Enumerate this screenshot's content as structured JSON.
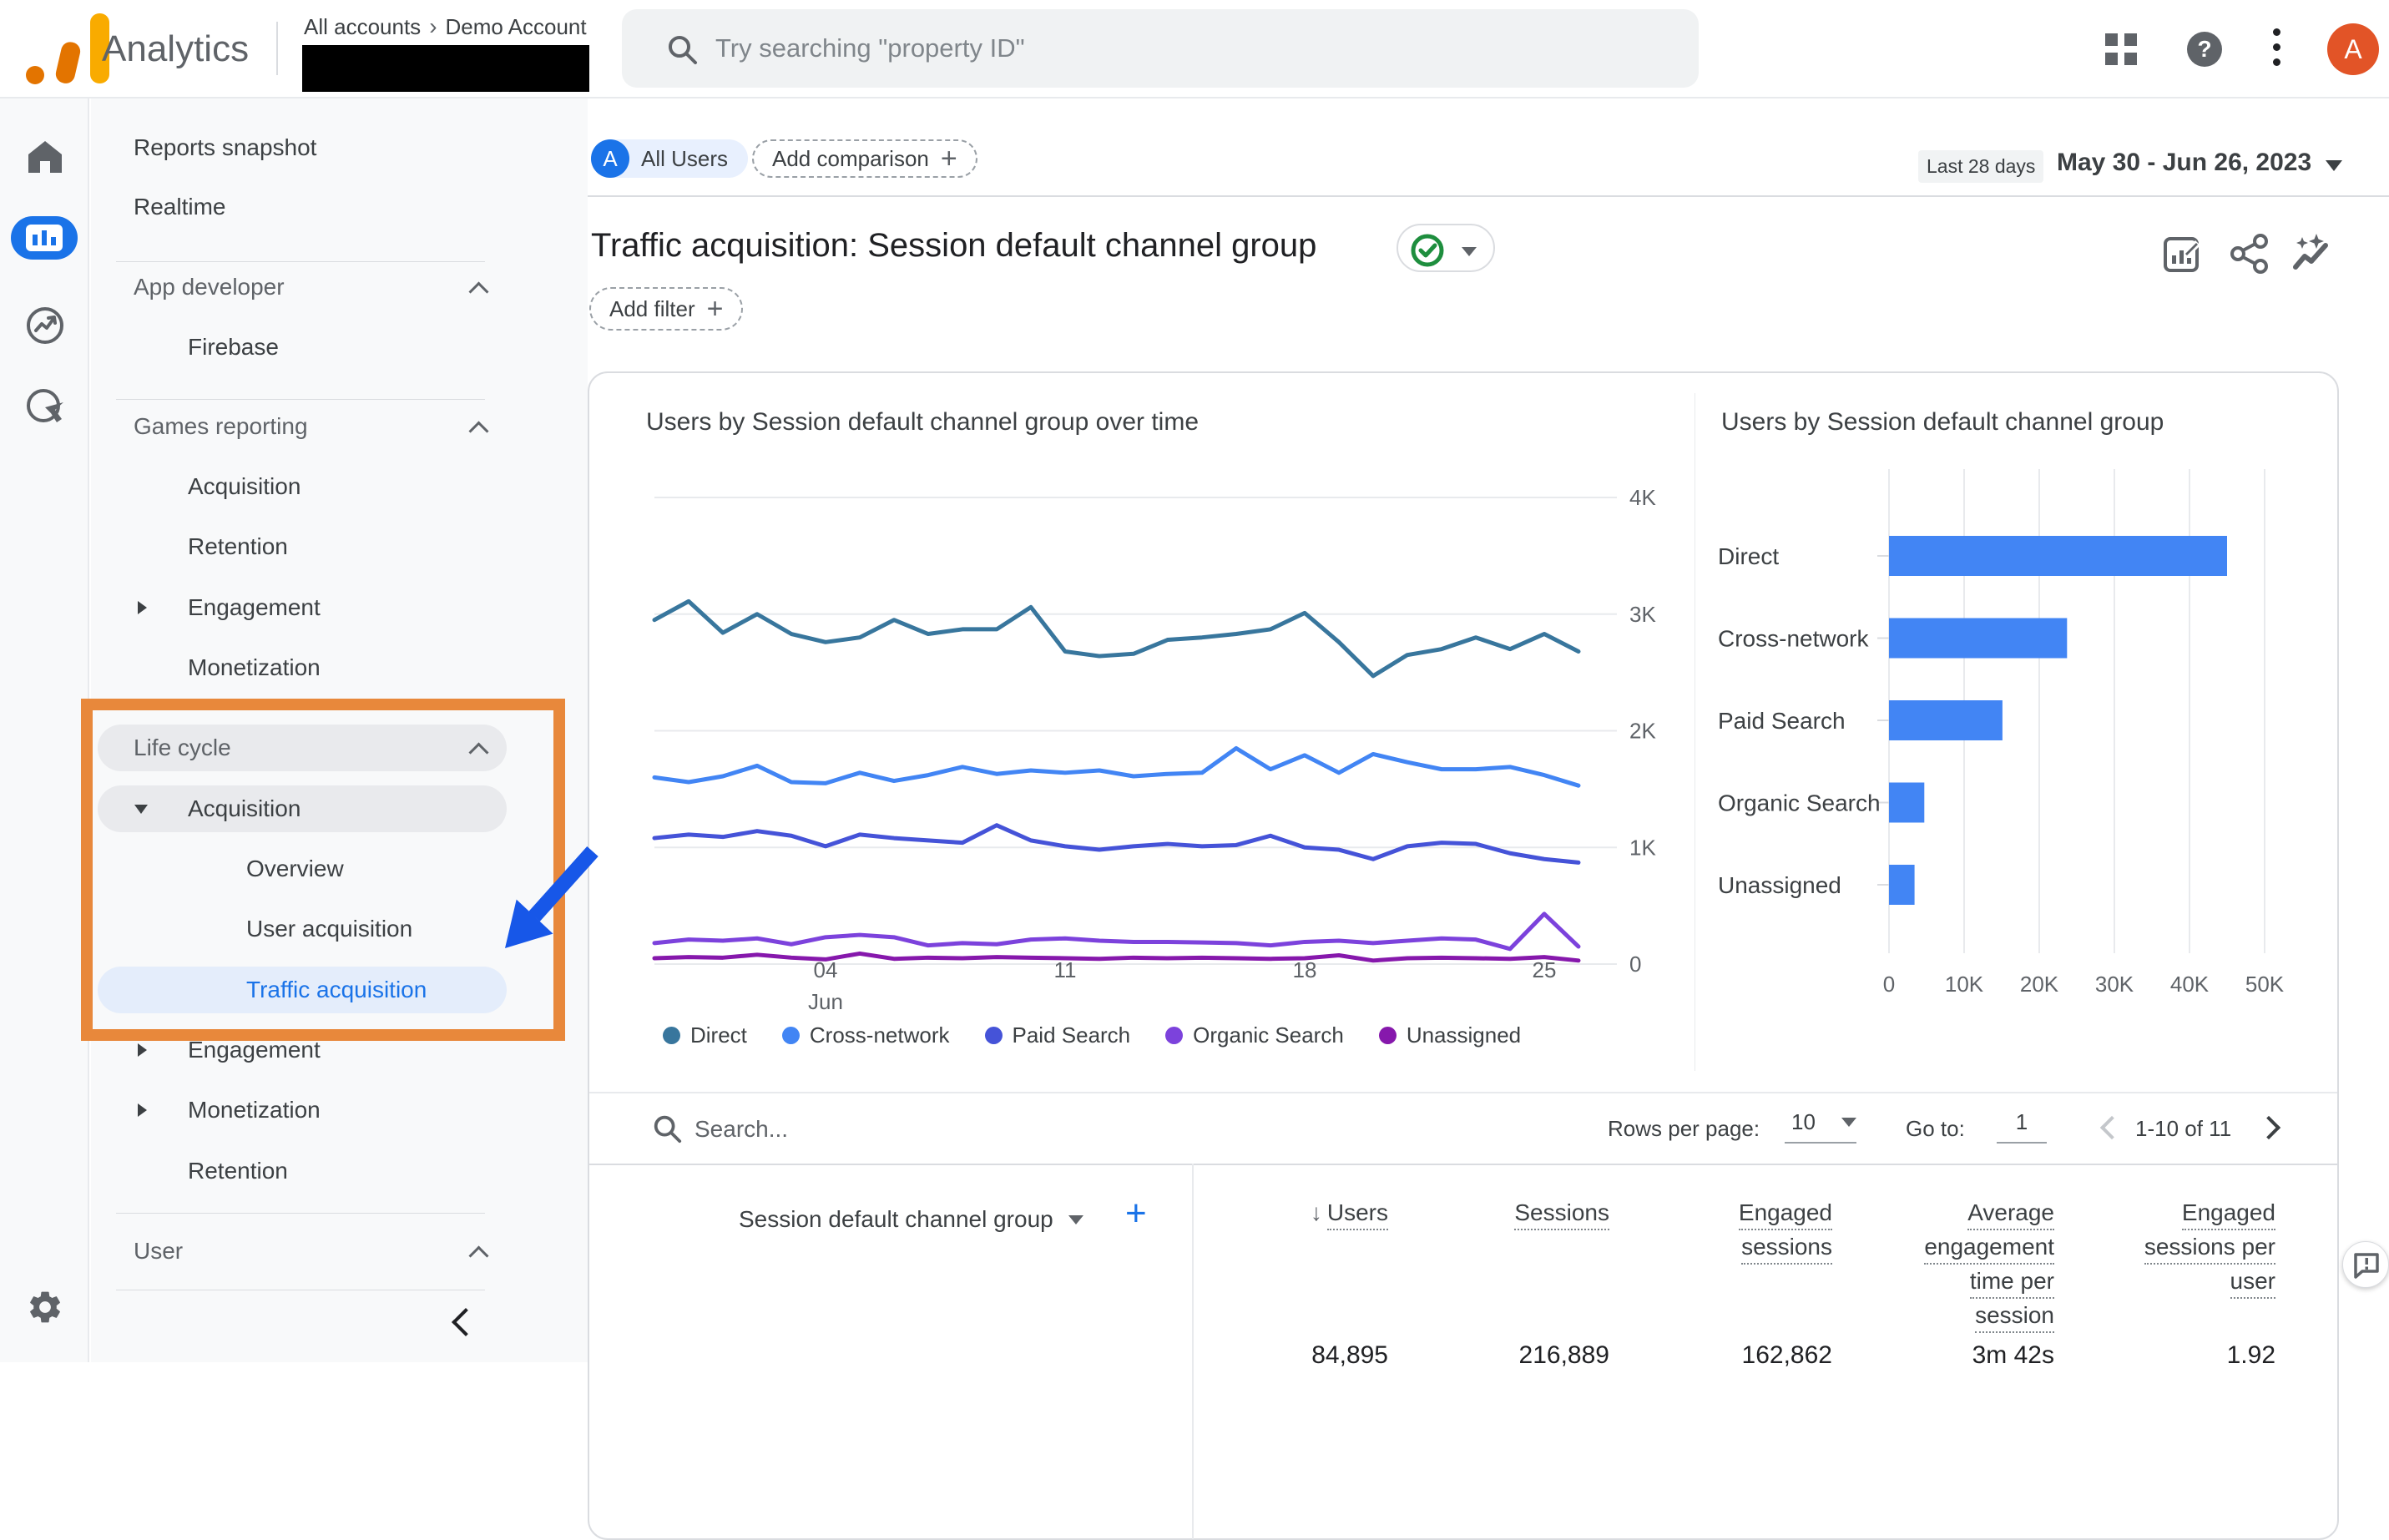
{
  "topbar": {
    "product": "Analytics",
    "breadcrumb": {
      "root": "All accounts",
      "account": "Demo Account"
    },
    "search_placeholder": "Try searching \"property ID\"",
    "avatar_letter": "A"
  },
  "rail": {
    "items": [
      "home",
      "reports",
      "explore",
      "advertising"
    ],
    "selected": "reports",
    "bottom": "settings"
  },
  "sidenav": {
    "items": [
      {
        "type": "item",
        "label": "Reports snapshot",
        "indent": 1
      },
      {
        "type": "item",
        "label": "Realtime",
        "indent": 1
      },
      {
        "type": "divider"
      },
      {
        "type": "header",
        "label": "App developer"
      },
      {
        "type": "item",
        "label": "Firebase",
        "indent": 2
      },
      {
        "type": "divider"
      },
      {
        "type": "header",
        "label": "Games reporting"
      },
      {
        "type": "item",
        "label": "Acquisition",
        "indent": 2
      },
      {
        "type": "item",
        "label": "Retention",
        "indent": 2
      },
      {
        "type": "item",
        "label": "Engagement",
        "indent": 2,
        "expand": "collapsed"
      },
      {
        "type": "item",
        "label": "Monetization",
        "indent": 2
      },
      {
        "type": "header",
        "label": "Life cycle",
        "pill": true
      },
      {
        "type": "item",
        "label": "Acquisition",
        "indent": 2,
        "expand": "expanded",
        "pill": "grey"
      },
      {
        "type": "item",
        "label": "Overview",
        "indent": 3
      },
      {
        "type": "item",
        "label": "User acquisition",
        "indent": 3
      },
      {
        "type": "item",
        "label": "Traffic acquisition",
        "indent": 3,
        "selected": true
      },
      {
        "type": "item",
        "label": "Engagement",
        "indent": 2,
        "expand": "collapsed"
      },
      {
        "type": "item",
        "label": "Monetization",
        "indent": 2,
        "expand": "collapsed"
      },
      {
        "type": "item",
        "label": "Retention",
        "indent": 2
      },
      {
        "type": "divider"
      },
      {
        "type": "header",
        "label": "User"
      },
      {
        "type": "divider"
      }
    ]
  },
  "header": {
    "all_users_chip": "All Users",
    "chip_avatar": "A",
    "add_comparison": "Add comparison",
    "date_range_label": "Last 28 days",
    "date_range": "May 30 - Jun 26, 2023",
    "title": "Traffic acquisition: Session default channel group",
    "add_filter": "Add filter"
  },
  "chart_data": [
    {
      "type": "line",
      "title": "Users by Session default channel group over time",
      "ylabel": "",
      "xlabel": "",
      "ylim": [
        0,
        4000
      ],
      "yticks": [
        "0",
        "1K",
        "2K",
        "3K",
        "4K"
      ],
      "x_ticks": [
        {
          "index": 5,
          "label": "04",
          "sublabel": "Jun"
        },
        {
          "index": 12,
          "label": "11"
        },
        {
          "index": 19,
          "label": "18"
        },
        {
          "index": 26,
          "label": "25"
        }
      ],
      "series": [
        {
          "name": "Direct",
          "color": "#38769d",
          "values": [
            2950,
            3110,
            2840,
            3000,
            2830,
            2760,
            2800,
            2950,
            2830,
            2870,
            2870,
            3060,
            2680,
            2640,
            2660,
            2780,
            2800,
            2830,
            2870,
            3010,
            2760,
            2470,
            2650,
            2700,
            2800,
            2700,
            2830,
            2680
          ]
        },
        {
          "name": "Cross-network",
          "color": "#4285f4",
          "values": [
            1600,
            1560,
            1610,
            1700,
            1560,
            1550,
            1640,
            1570,
            1620,
            1690,
            1630,
            1660,
            1640,
            1660,
            1610,
            1630,
            1640,
            1850,
            1670,
            1790,
            1640,
            1800,
            1730,
            1670,
            1670,
            1690,
            1620,
            1530
          ]
        },
        {
          "name": "Paid Search",
          "color": "#4553d8",
          "values": [
            1080,
            1110,
            1090,
            1140,
            1100,
            1010,
            1110,
            1080,
            1060,
            1040,
            1190,
            1060,
            1010,
            980,
            1010,
            1030,
            1010,
            1020,
            1100,
            1000,
            980,
            900,
            1010,
            1040,
            1030,
            950,
            900,
            870
          ]
        },
        {
          "name": "Organic Search",
          "color": "#7c42dc",
          "values": [
            180,
            210,
            200,
            220,
            170,
            230,
            250,
            230,
            160,
            180,
            170,
            210,
            220,
            200,
            190,
            190,
            185,
            180,
            160,
            190,
            200,
            180,
            200,
            220,
            210,
            130,
            430,
            150
          ]
        },
        {
          "name": "Unassigned",
          "color": "#8618ac",
          "values": [
            50,
            60,
            55,
            80,
            55,
            40,
            90,
            45,
            55,
            50,
            60,
            55,
            50,
            45,
            55,
            50,
            55,
            50,
            45,
            50,
            75,
            30,
            50,
            55,
            50,
            45,
            60,
            30
          ]
        }
      ]
    },
    {
      "type": "bar",
      "title": "Users by Session default channel group",
      "categories": [
        "Direct",
        "Cross-network",
        "Paid Search",
        "Organic Search",
        "Unassigned"
      ],
      "values": [
        45000,
        23700,
        15100,
        4700,
        3400
      ],
      "xlim": [
        0,
        50000
      ],
      "xticks": [
        "0",
        "10K",
        "20K",
        "30K",
        "40K",
        "50K"
      ],
      "bar_color": "#4285f4"
    }
  ],
  "table": {
    "search_placeholder": "Search...",
    "rows_per_page_label": "Rows per page:",
    "rows_per_page_value": "10",
    "goto_label": "Go to:",
    "goto_value": "1",
    "pagination": "1-10 of 11",
    "dimension_header": "Session default channel group",
    "columns": [
      {
        "label": "Users",
        "sorted": true
      },
      {
        "label": "Sessions"
      },
      {
        "label": "Engaged sessions"
      },
      {
        "label": "Average engagement time per session"
      },
      {
        "label": "Engaged sessions per user"
      }
    ],
    "totals": [
      "84,895",
      "216,889",
      "162,862",
      "3m 42s",
      "1.92"
    ]
  }
}
